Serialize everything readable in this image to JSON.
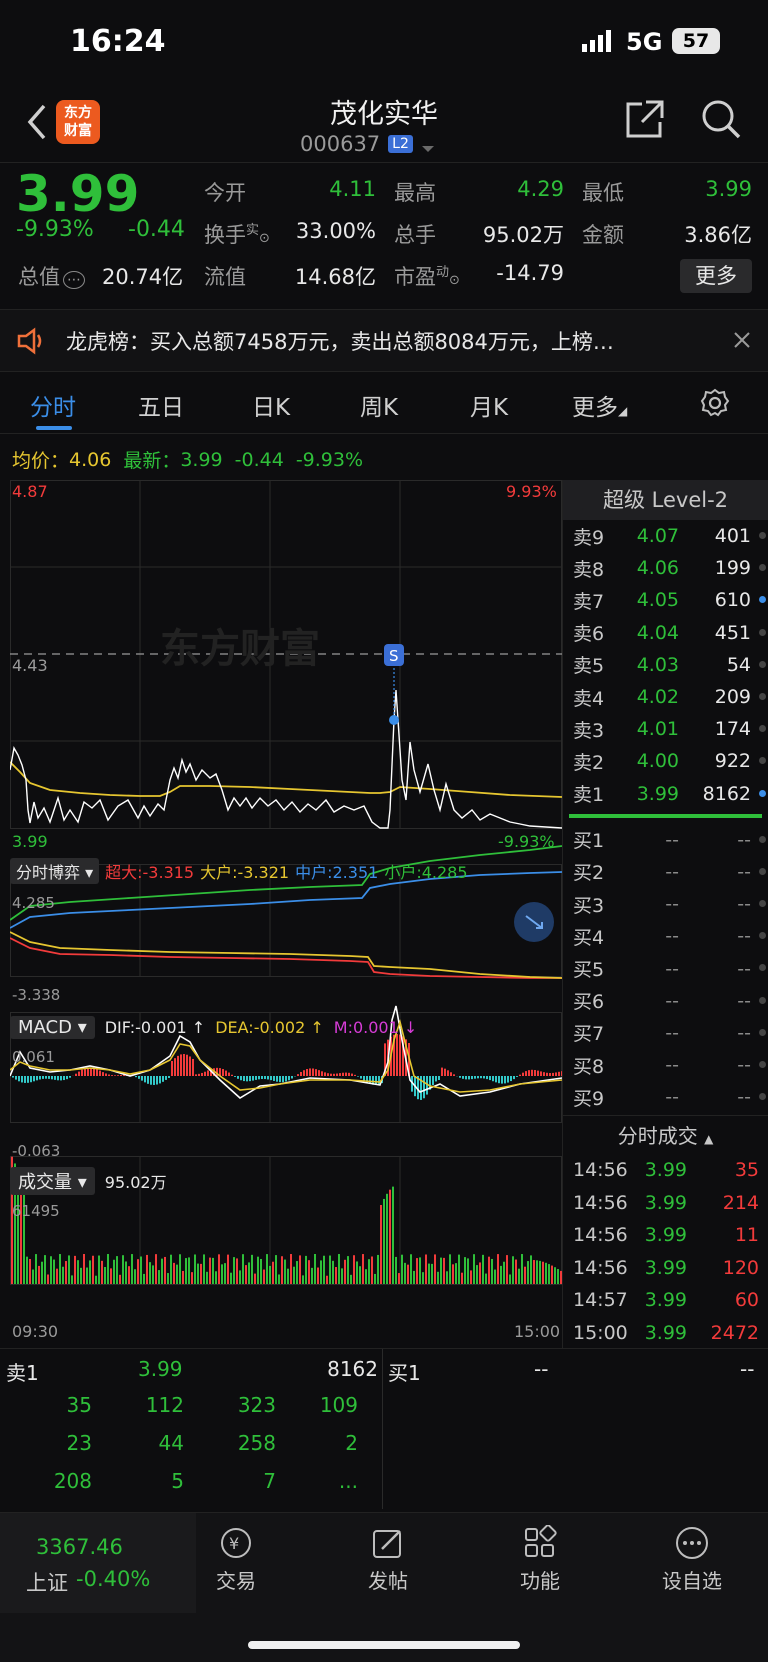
{
  "status": {
    "time": "16:24",
    "network": "5G",
    "battery": "57"
  },
  "header": {
    "title": "茂化实华",
    "code": "000637",
    "l2": "L2"
  },
  "quote": {
    "price": "3.99",
    "pct": "-9.93%",
    "chg": "-0.44",
    "fields": [
      {
        "label": "今开",
        "value": "4.11",
        "color": "green"
      },
      {
        "label": "最高",
        "value": "4.29",
        "color": "green"
      },
      {
        "label": "最低",
        "value": "3.99",
        "color": "green"
      },
      {
        "label": "换手",
        "sup": "实",
        "value": "33.00%",
        "color": "white"
      },
      {
        "label": "总手",
        "value": "95.02万",
        "color": "white"
      },
      {
        "label": "金额",
        "value": "3.86亿",
        "color": "white"
      },
      {
        "label": "总值",
        "value": "20.74亿",
        "color": "white"
      },
      {
        "label": "流值",
        "value": "14.68亿",
        "color": "white"
      },
      {
        "label": "市盈",
        "sup": "动",
        "value": "-14.79",
        "color": "white"
      }
    ],
    "more": "更多"
  },
  "notice": {
    "text": "龙虎榜：买入总额7458万元，卖出总额8084万元，上榜…"
  },
  "tabs": [
    "分时",
    "五日",
    "日K",
    "周K",
    "月K",
    "更多"
  ],
  "info_line": {
    "avg_label": "均价：",
    "avg": "4.06",
    "latest_label": "最新：",
    "latest": "3.99",
    "chg": "-0.44",
    "pct": "-9.93%"
  },
  "main_chart": {
    "ymax": "4.87",
    "ymax_pct": "9.93%",
    "mid": "4.43",
    "ymin": "3.99",
    "ymin_pct": "-9.93%",
    "watermark": "东方财富"
  },
  "game": {
    "title": "分时博弈",
    "super": "超大:-3.315",
    "large": "大户:-3.321",
    "mid": "中户:2.351",
    "small": "小户:4.285",
    "top": "4.285",
    "bottom": "-3.338"
  },
  "macd": {
    "title": "MACD",
    "dif": "DIF:-0.001 ↑",
    "dea": "DEA:-0.002 ↑",
    "m": "M:0.001 ↓",
    "top": "0.061",
    "bottom": "-0.063"
  },
  "volume": {
    "title": "成交量",
    "total": "95.02万",
    "max": "61495",
    "start": "09:30",
    "end": "15:00"
  },
  "level2": {
    "title": "超级 Level-2",
    "asks": [
      [
        "卖9",
        "4.07",
        "401"
      ],
      [
        "卖8",
        "4.06",
        "199"
      ],
      [
        "卖7",
        "4.05",
        "610"
      ],
      [
        "卖6",
        "4.04",
        "451"
      ],
      [
        "卖5",
        "4.03",
        "54"
      ],
      [
        "卖4",
        "4.02",
        "209"
      ],
      [
        "卖3",
        "4.01",
        "174"
      ],
      [
        "卖2",
        "4.00",
        "922"
      ],
      [
        "卖1",
        "3.99",
        "8162"
      ]
    ],
    "bids": [
      [
        "买1",
        "--",
        "--"
      ],
      [
        "买2",
        "--",
        "--"
      ],
      [
        "买3",
        "--",
        "--"
      ],
      [
        "买4",
        "--",
        "--"
      ],
      [
        "买5",
        "--",
        "--"
      ],
      [
        "买6",
        "--",
        "--"
      ],
      [
        "买7",
        "--",
        "--"
      ],
      [
        "买8",
        "--",
        "--"
      ],
      [
        "买9",
        "--",
        "--"
      ]
    ]
  },
  "trades": {
    "title": "分时成交",
    "rows": [
      [
        "14:56",
        "3.99",
        "35"
      ],
      [
        "14:56",
        "3.99",
        "214"
      ],
      [
        "14:56",
        "3.99",
        "11"
      ],
      [
        "14:56",
        "3.99",
        "120"
      ],
      [
        "14:57",
        "3.99",
        "60"
      ],
      [
        "15:00",
        "3.99",
        "2472"
      ]
    ]
  },
  "queue": {
    "sell_label": "卖1",
    "sell_price": "3.99",
    "sell_vol": "8162",
    "buy_label": "买1",
    "buy_val": "--",
    "rows": [
      [
        "35",
        "112",
        "323",
        "109"
      ],
      [
        "23",
        "44",
        "258",
        "2"
      ],
      [
        "208",
        "5",
        "7",
        "..."
      ]
    ]
  },
  "bottom": {
    "index_value": "3367.46",
    "index_name": "上证",
    "index_pct": "-0.40%",
    "items": [
      "交易",
      "发帖",
      "功能",
      "设自选"
    ]
  }
}
